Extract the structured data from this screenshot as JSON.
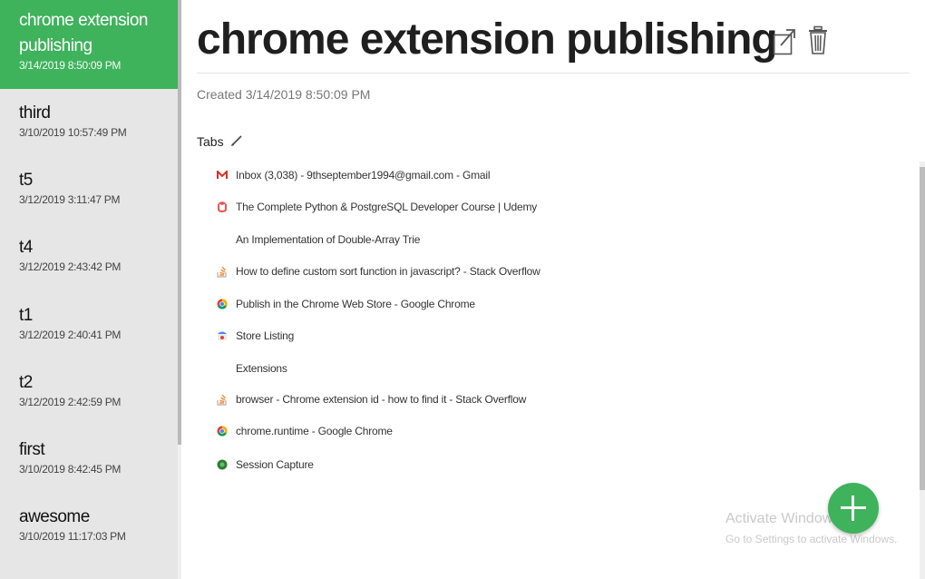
{
  "sidebar": {
    "sessions": [
      {
        "name": "chrome extension publishing",
        "date": "3/14/2019 8:50:09 PM",
        "active": true
      },
      {
        "name": "third",
        "date": "3/10/2019 10:57:49 PM"
      },
      {
        "name": "t5",
        "date": "3/12/2019 3:11:47 PM"
      },
      {
        "name": "t4",
        "date": "3/12/2019 2:43:42 PM"
      },
      {
        "name": "t1",
        "date": "3/12/2019 2:40:41 PM"
      },
      {
        "name": "t2",
        "date": "3/12/2019 2:42:59 PM"
      },
      {
        "name": "first",
        "date": "3/10/2019 8:42:45 PM"
      },
      {
        "name": "awesome",
        "date": "3/10/2019 11:17:03 PM"
      }
    ]
  },
  "main": {
    "title": "chrome extension publishing",
    "created": "Created 3/14/2019 8:50:09 PM",
    "tabs_heading": "Tabs",
    "tabs": [
      {
        "title": "Inbox (3,038) - 9thseptember1994@gmail.com - Gmail",
        "icon": "gmail-icon"
      },
      {
        "title": "The Complete Python & PostgreSQL Developer Course | Udemy",
        "icon": "udemy-icon"
      },
      {
        "title": "An Implementation of Double-Array Trie",
        "icon": "none"
      },
      {
        "title": "How to define custom sort function in javascript? - Stack Overflow",
        "icon": "stackoverflow-icon"
      },
      {
        "title": "Publish in the Chrome Web Store - Google Chrome",
        "icon": "chrome-icon"
      },
      {
        "title": "Store Listing",
        "icon": "webstore-icon"
      },
      {
        "title": "Extensions",
        "icon": "none"
      },
      {
        "title": "browser - Chrome extension id - how to find it - Stack Overflow",
        "icon": "stackoverflow-icon"
      },
      {
        "title": "chrome.runtime - Google Chrome",
        "icon": "chrome-icon"
      },
      {
        "title": "Session Capture",
        "icon": "session-capture-icon"
      }
    ]
  },
  "watermark": {
    "line1": "Activate Windows",
    "line2": "Go to Settings to activate Windows."
  },
  "colors": {
    "accent": "#3fb25c",
    "sidebar_bg": "#e6e6e6"
  }
}
